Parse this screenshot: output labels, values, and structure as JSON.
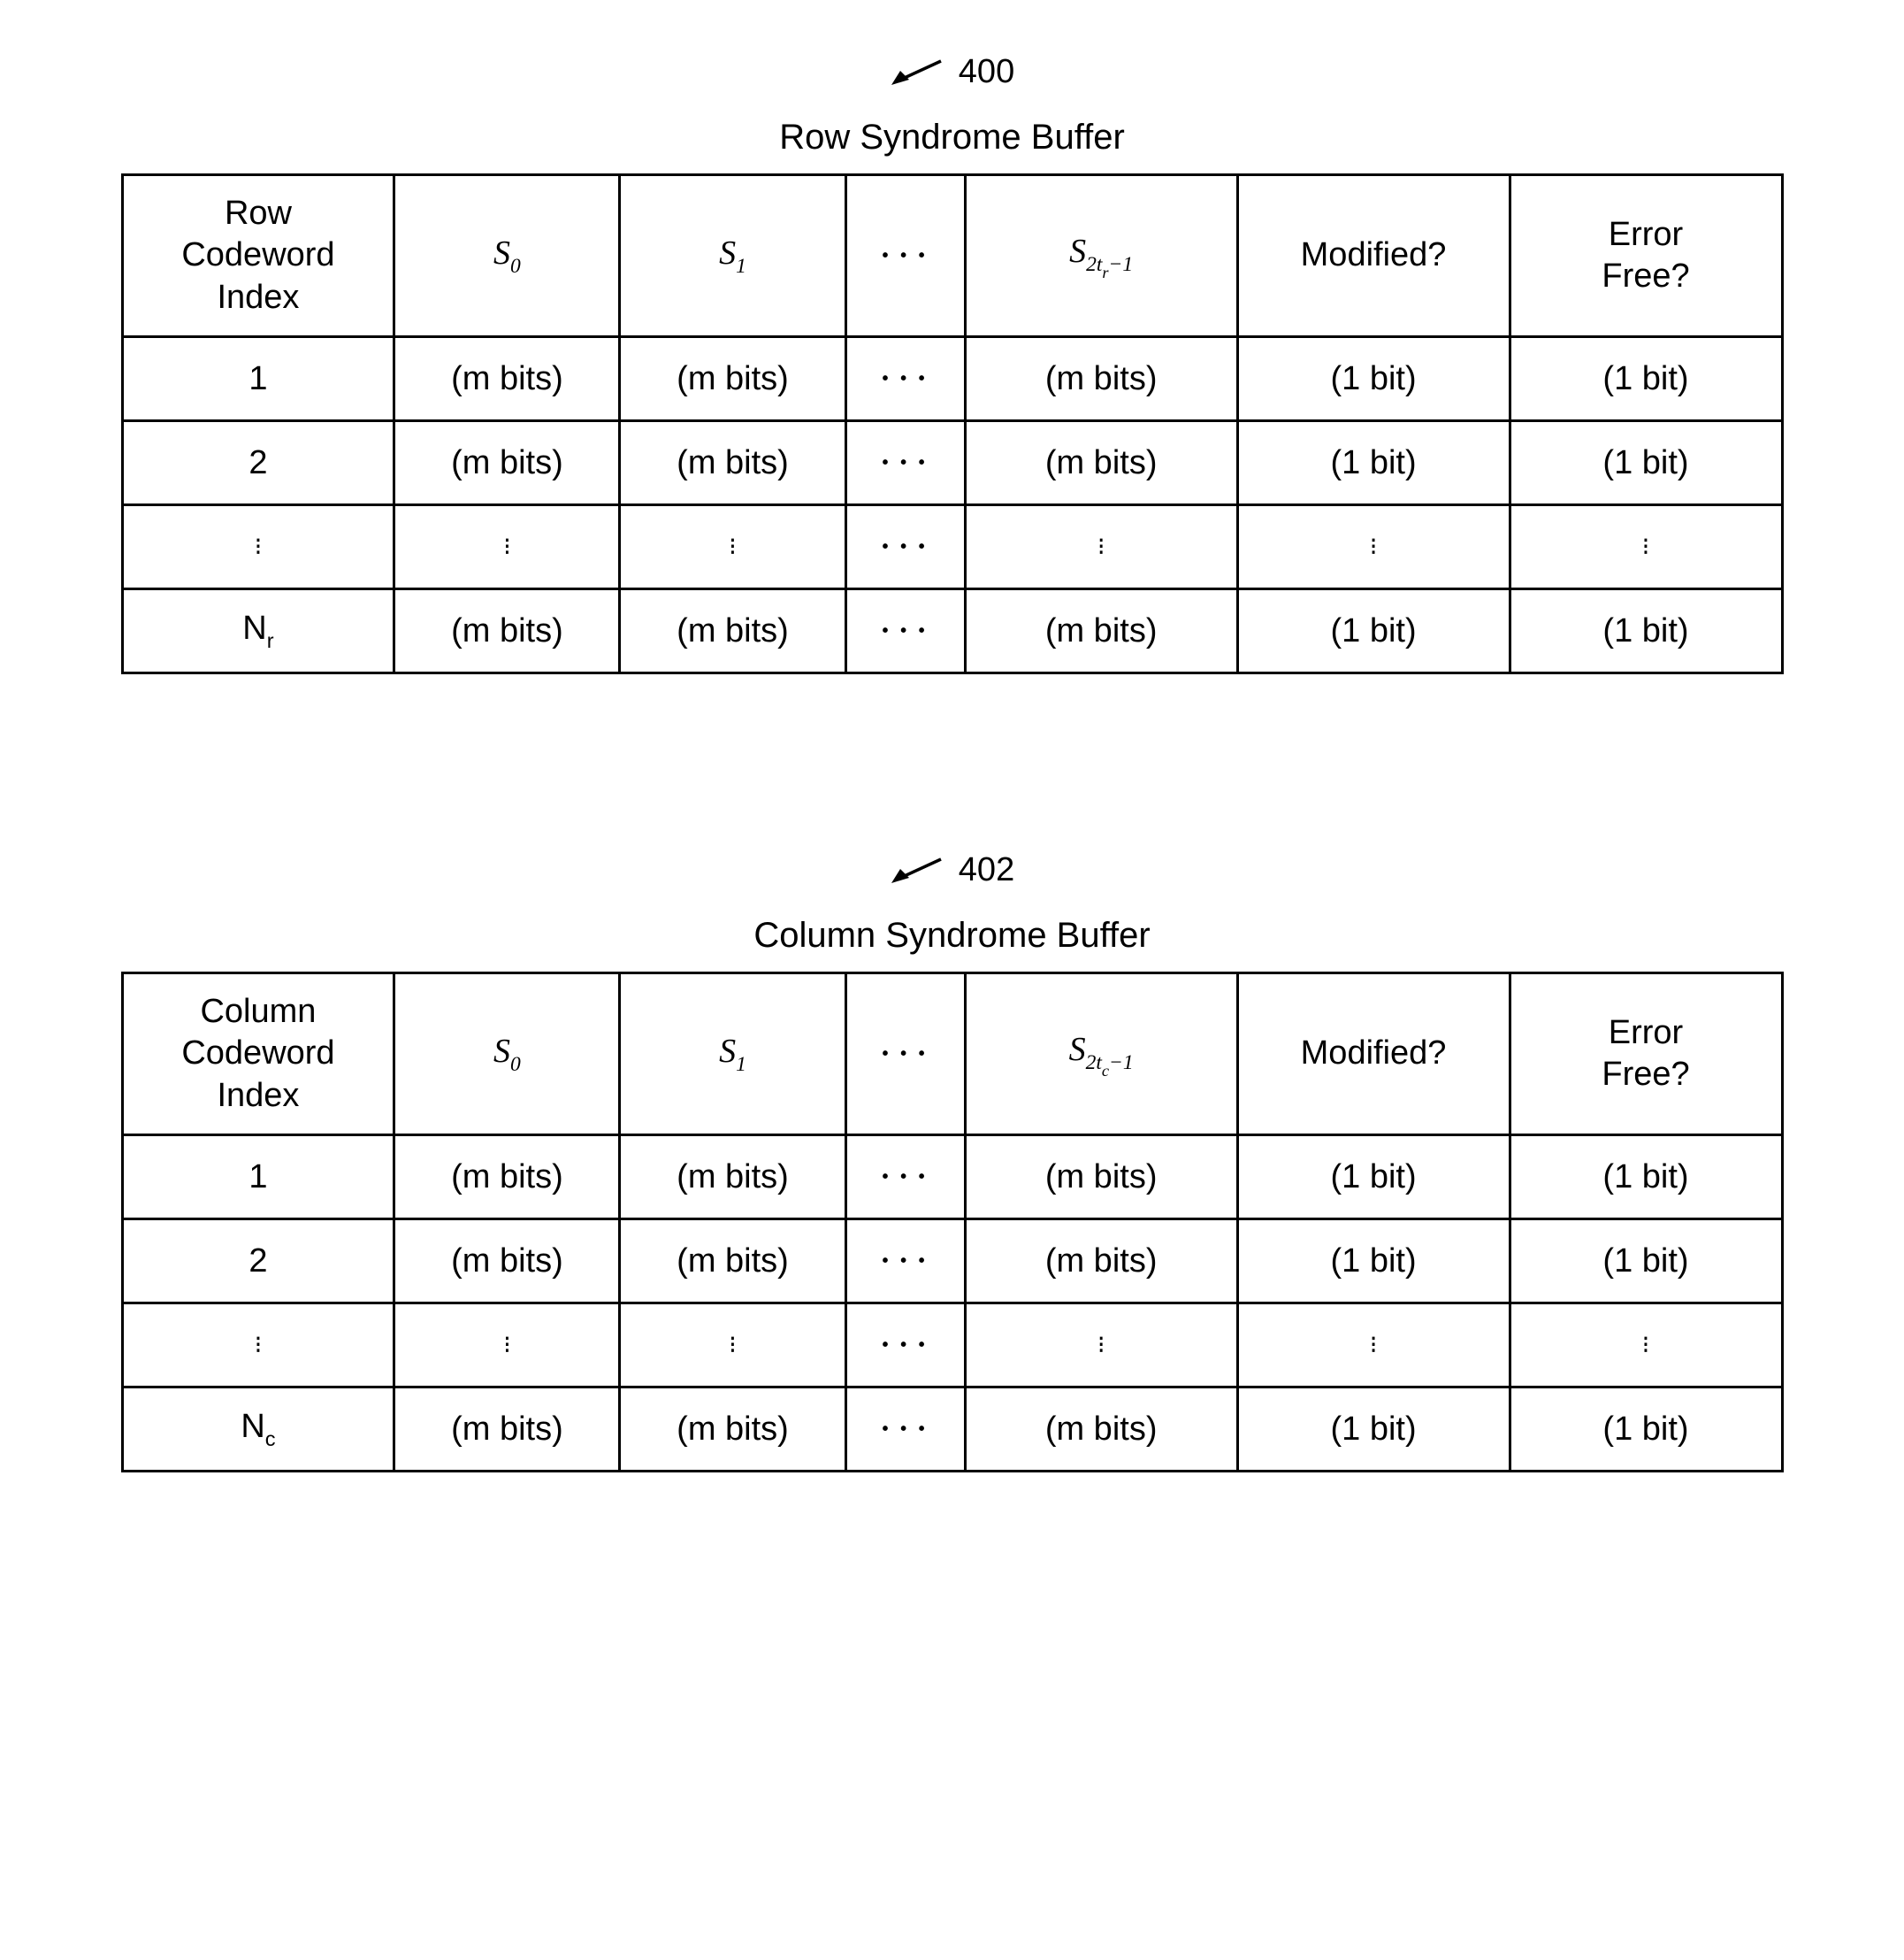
{
  "figure1": {
    "ref": "400",
    "title": "Row Syndrome Buffer",
    "headers": {
      "index": "Row\nCodeword\nIndex",
      "s0_base": "S",
      "s0_sub": "0",
      "s1_base": "S",
      "s1_sub": "1",
      "slast_base": "S",
      "slast_sub_prefix": "2t",
      "slast_sub_var": "r",
      "slast_sub_suffix": "−1",
      "modified": "Modified?",
      "errorfree": "Error\nFree?"
    },
    "rows": [
      {
        "idx": "1",
        "s": "(m bits)",
        "mod": "(1 bit)",
        "err": "(1 bit)"
      },
      {
        "idx": "2",
        "s": "(m bits)",
        "mod": "(1 bit)",
        "err": "(1 bit)"
      },
      {
        "vdots": true
      },
      {
        "idx_base": "N",
        "idx_sub": "r",
        "s": "(m bits)",
        "mod": "(1 bit)",
        "err": "(1 bit)"
      }
    ]
  },
  "figure2": {
    "ref": "402",
    "title": "Column Syndrome Buffer",
    "headers": {
      "index": "Column\nCodeword\nIndex",
      "s0_base": "S",
      "s0_sub": "0",
      "s1_base": "S",
      "s1_sub": "1",
      "slast_base": "S",
      "slast_sub_prefix": "2t",
      "slast_sub_var": "c",
      "slast_sub_suffix": "−1",
      "modified": "Modified?",
      "errorfree": "Error\nFree?"
    },
    "rows": [
      {
        "idx": "1",
        "s": "(m bits)",
        "mod": "(1 bit)",
        "err": "(1 bit)"
      },
      {
        "idx": "2",
        "s": "(m bits)",
        "mod": "(1 bit)",
        "err": "(1 bit)"
      },
      {
        "vdots": true
      },
      {
        "idx_base": "N",
        "idx_sub": "c",
        "s": "(m bits)",
        "mod": "(1 bit)",
        "err": "(1 bit)"
      }
    ]
  },
  "hdots": "• • •",
  "vdots": "⁝"
}
